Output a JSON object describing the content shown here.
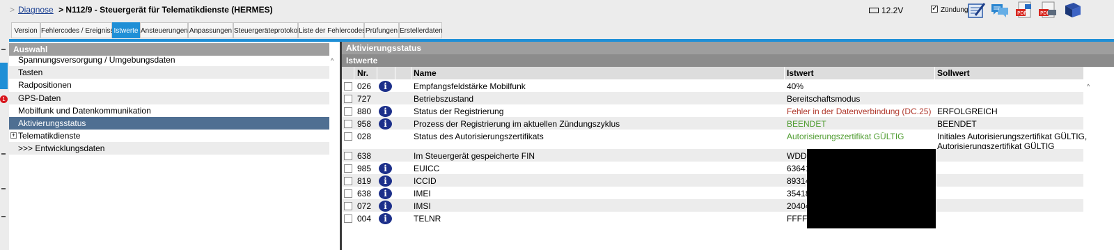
{
  "breadcrumb": {
    "separator": ">",
    "root": "Diagnose",
    "arrow": ">",
    "current": "N112/9 - Steuergerät für Telematikdienste (HERMES)"
  },
  "status": {
    "voltage": "12.2V",
    "ignition_label": "Zündung",
    "ignition_checked": true
  },
  "toolbar_icons": [
    "edit-notepad-icon",
    "chat-bubbles-icon",
    "pdf-export-icon",
    "pdf-print-icon",
    "manual-book-icon"
  ],
  "badge_count": "1",
  "tabs": [
    {
      "label": "Version",
      "active": false
    },
    {
      "label": "Fehlercodes / Ereignisse",
      "active": false
    },
    {
      "label": "Istwerte",
      "active": true
    },
    {
      "label": "Ansteuerungen",
      "active": false
    },
    {
      "label": "Anpassungen",
      "active": false
    },
    {
      "label": "Steuergeräteprotokoll",
      "active": false
    },
    {
      "label": "Liste der Fehlercodes",
      "active": false
    },
    {
      "label": "Prüfungen",
      "active": false
    },
    {
      "label": "Erstellerdaten",
      "active": false
    }
  ],
  "left": {
    "title": "Auswahl",
    "items": [
      {
        "label": "Spannungsversorgung / Umgebungsdaten",
        "selected": false,
        "expandable": false
      },
      {
        "label": "Tasten",
        "selected": false,
        "expandable": false
      },
      {
        "label": "Radpositionen",
        "selected": false,
        "expandable": false
      },
      {
        "label": "GPS-Daten",
        "selected": false,
        "expandable": false
      },
      {
        "label": "Mobilfunk und Datenkommunikation",
        "selected": false,
        "expandable": false
      },
      {
        "label": "Aktivierungsstatus",
        "selected": true,
        "expandable": false
      },
      {
        "label": "Telematikdienste",
        "selected": false,
        "expandable": true
      },
      {
        "label": ">>> Entwicklungsdaten",
        "selected": false,
        "expandable": false
      }
    ]
  },
  "right": {
    "title": "Aktivierungsstatus",
    "subtitle": "Istwerte",
    "columns": {
      "nr": "Nr.",
      "name": "Name",
      "istwert": "Istwert",
      "sollwert": "Sollwert"
    },
    "rows": [
      {
        "nr": "026",
        "info": true,
        "name": "Empfangsfeldstärke Mobilfunk",
        "ist": "40%",
        "ist_color": "normal",
        "soll": ""
      },
      {
        "nr": "727",
        "info": false,
        "name": "Betriebszustand",
        "ist": "Bereitschaftsmodus",
        "ist_color": "normal",
        "soll": ""
      },
      {
        "nr": "880",
        "info": true,
        "name": "Status der Registrierung",
        "ist": "Fehler in der Datenverbindung (DC.25)",
        "ist_color": "red",
        "soll": "ERFOLGREICH"
      },
      {
        "nr": "958",
        "info": true,
        "name": "Prozess der Registrierung im aktuellen Zündungszyklus",
        "ist": "BEENDET",
        "ist_color": "green",
        "soll": "BEENDET"
      },
      {
        "nr": "028",
        "info": false,
        "name": "Status des Autorisierungszertifikats",
        "ist": "Autorisierungszertifikat GÜLTIG",
        "ist_color": "green",
        "soll": "Initiales Autorisierungszertifikat GÜLTIG,",
        "soll2": "Autorisierungszertifikat GÜLTIG"
      },
      {
        "nr": "638",
        "info": false,
        "name": "Im Steuergerät gespeicherte FIN",
        "ist": "WDD",
        "ist_color": "normal",
        "soll": ""
      },
      {
        "nr": "985",
        "info": true,
        "name": "EUICC",
        "ist": "63641",
        "ist_color": "normal",
        "soll": ""
      },
      {
        "nr": "819",
        "info": true,
        "name": "ICCID",
        "ist": "89314",
        "ist_color": "normal",
        "soll": ""
      },
      {
        "nr": "638",
        "info": true,
        "name": "IMEI",
        "ist": "35418",
        "ist_color": "normal",
        "soll": ""
      },
      {
        "nr": "072",
        "info": true,
        "name": "IMSI",
        "ist": "20404",
        "ist_color": "normal",
        "soll": ""
      },
      {
        "nr": "004",
        "info": true,
        "name": "TELNR",
        "ist": "FFFF",
        "ist_color": "normal",
        "soll": ""
      }
    ]
  },
  "colors": {
    "accent": "#1f8fd6",
    "header_gray": "#9e9e9e",
    "selection": "#4f6f92",
    "error_text": "#b03a2e",
    "ok_text": "#4e9c2f",
    "info_icon": "#1c2f8a"
  }
}
